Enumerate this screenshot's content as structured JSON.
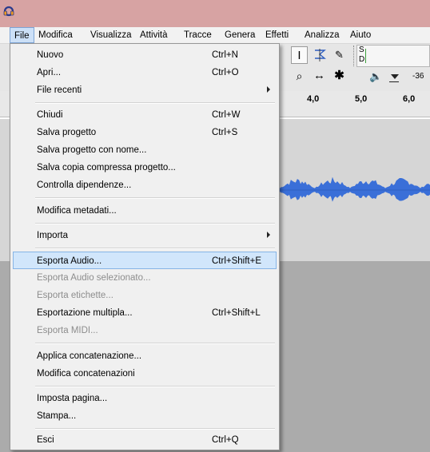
{
  "menubar": {
    "items": [
      "File",
      "Modifica",
      "Visualizza",
      "Attività",
      "Tracce",
      "Genera",
      "Effetti",
      "Analizza",
      "Aiuto"
    ]
  },
  "toolbar": {
    "meter_s": "S",
    "meter_d": "D",
    "meter_value": "-36"
  },
  "ruler": {
    "ticks": [
      "4,0",
      "5,0",
      "6,0"
    ]
  },
  "file_menu": {
    "items": [
      {
        "label": "Nuovo",
        "shortcut": "Ctrl+N"
      },
      {
        "label": "Apri...",
        "shortcut": "Ctrl+O"
      },
      {
        "label": "File recenti",
        "shortcut": ""
      },
      {
        "label": "Chiudi",
        "shortcut": "Ctrl+W"
      },
      {
        "label": "Salva progetto",
        "shortcut": "Ctrl+S"
      },
      {
        "label": "Salva progetto con nome...",
        "shortcut": ""
      },
      {
        "label": "Salva copia compressa progetto...",
        "shortcut": ""
      },
      {
        "label": "Controlla dipendenze...",
        "shortcut": ""
      },
      {
        "label": "Modifica metadati...",
        "shortcut": ""
      },
      {
        "label": "Importa",
        "shortcut": ""
      },
      {
        "label": "Esporta Audio...",
        "shortcut": "Ctrl+Shift+E"
      },
      {
        "label": "Esporta Audio selezionato...",
        "shortcut": ""
      },
      {
        "label": "Esporta etichette...",
        "shortcut": ""
      },
      {
        "label": "Esportazione multipla...",
        "shortcut": "Ctrl+Shift+L"
      },
      {
        "label": "Esporta MIDI...",
        "shortcut": ""
      },
      {
        "label": "Applica concatenazione...",
        "shortcut": ""
      },
      {
        "label": "Modifica concatenazioni",
        "shortcut": ""
      },
      {
        "label": "Imposta pagina...",
        "shortcut": ""
      },
      {
        "label": "Stampa...",
        "shortcut": ""
      },
      {
        "label": "Esci",
        "shortcut": "Ctrl+Q"
      }
    ]
  },
  "colors": {
    "titlebar": "#d7a3a3",
    "menu_highlight": "#d1e6fb",
    "waveform": "#3a6fd8"
  }
}
